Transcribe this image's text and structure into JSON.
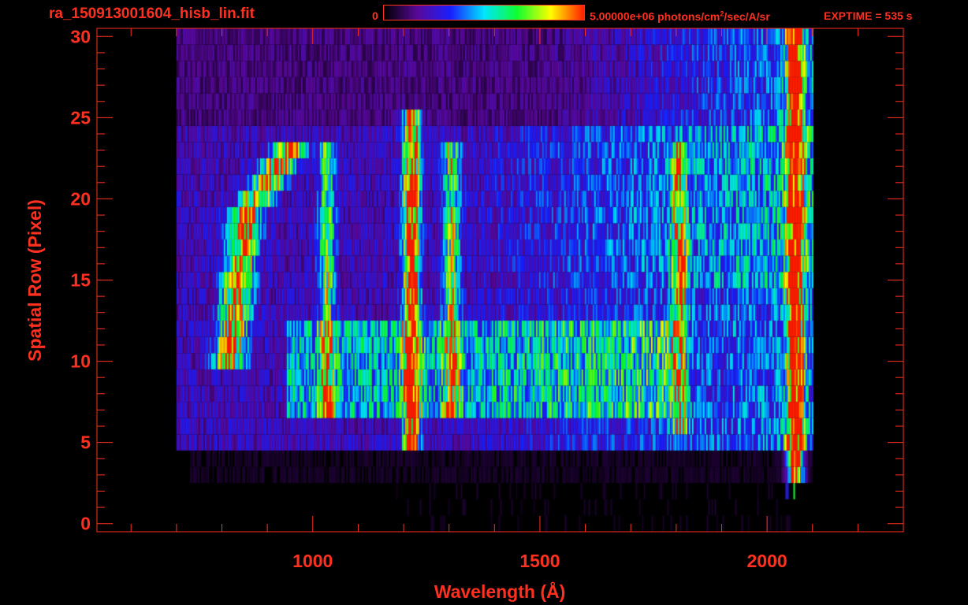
{
  "header": {
    "title": "ra_150913001604_hisb_lin.fit",
    "colorbar_min": "0",
    "colorbar_max_value": "5.00000e+06",
    "colorbar_units_pre": "photons/cm",
    "colorbar_units_sup": "2",
    "colorbar_units_post": "/sec/A/sr",
    "exptime": "EXPTIME = 535 s"
  },
  "colors": {
    "axis": "#ff3020",
    "background": "#000000",
    "colormap": [
      "#000000",
      "#5a0a9a",
      "#1a20ff",
      "#00e6ff",
      "#10ff30",
      "#ffff00",
      "#ff2000"
    ]
  },
  "chart_data": {
    "type": "heatmap",
    "title": "ra_150913001604_hisb_lin.fit",
    "xlabel": "Wavelength (Å)",
    "ylabel": "Spatial Row (Pixel)",
    "xlim": [
      525,
      2300
    ],
    "ylim": [
      -0.5,
      30.5
    ],
    "xticks": [
      1000,
      1500,
      2000
    ],
    "yticks": [
      0,
      5,
      10,
      15,
      20,
      25,
      30
    ],
    "colorbar_range": [
      0,
      5000000
    ],
    "colorbar_units": "photons/cm^2/sec/A/sr",
    "data_extent": {
      "wavelength": [
        700,
        2100
      ],
      "rows": [
        0,
        30
      ]
    },
    "emission_features": [
      {
        "wavelength": 1216,
        "rows": [
          5,
          25
        ],
        "peak_level": 0.95
      },
      {
        "wavelength": 1304,
        "rows": [
          7,
          23
        ],
        "peak_level": 0.5
      },
      {
        "wavelength": 1030,
        "rows": [
          7,
          23
        ],
        "peak_level": 0.45
      },
      {
        "wavelength": 1806,
        "rows": [
          6,
          23
        ],
        "peak_level": 0.55
      },
      {
        "wavelength": 2060,
        "rows": [
          1,
          30
        ],
        "peak_level": 1.0
      }
    ],
    "bright_arc": {
      "wavelength": [
        800,
        945
      ],
      "rows": [
        10,
        23
      ],
      "peak_level": 0.75
    }
  }
}
